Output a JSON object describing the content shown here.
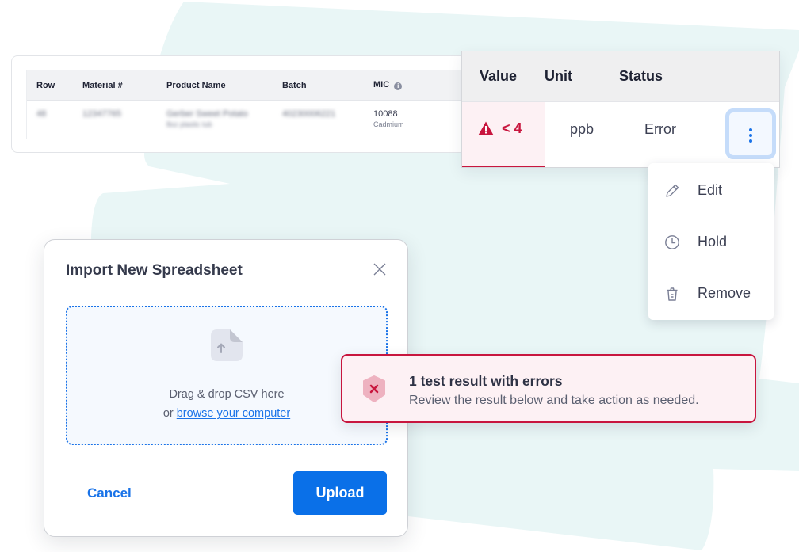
{
  "colors": {
    "accent": "#1a73e8",
    "error": "#c8163e",
    "error_bg": "#fdf1f4",
    "blob": "#e9f6f6"
  },
  "data_table": {
    "headers": [
      "Row",
      "Material #",
      "Product Name",
      "Batch",
      "MIC"
    ],
    "mic_info_icon": "info-icon",
    "row": {
      "row": "48",
      "material": "12347765",
      "product_name": "Gerber Sweet Potato",
      "product_sub": "8oz plastic tub",
      "batch": "40230006221",
      "mic": "10088",
      "mic_sub": "Cadmium"
    }
  },
  "result_table": {
    "headers": [
      "Value",
      "Unit",
      "Status"
    ],
    "row": {
      "value": "< 4",
      "value_icon": "warning-triangle-icon",
      "unit": "ppb",
      "status": "Error"
    },
    "actions_icon": "kebab-icon"
  },
  "action_menu": {
    "items": [
      {
        "label": "Edit",
        "icon": "pencil-icon"
      },
      {
        "label": "Hold",
        "icon": "clock-icon"
      },
      {
        "label": "Remove",
        "icon": "trash-icon"
      }
    ]
  },
  "import_modal": {
    "title": "Import New Spreadsheet",
    "close_icon": "close-icon",
    "dropzone": {
      "icon": "file-upload-icon",
      "line1": "Drag & drop CSV here",
      "line2_prefix": "or ",
      "link": "browse your computer"
    },
    "cancel_label": "Cancel",
    "upload_label": "Upload"
  },
  "error_toast": {
    "icon": "error-shield-icon",
    "title": "1 test result with errors",
    "message": "Review the result below and take action as needed."
  }
}
